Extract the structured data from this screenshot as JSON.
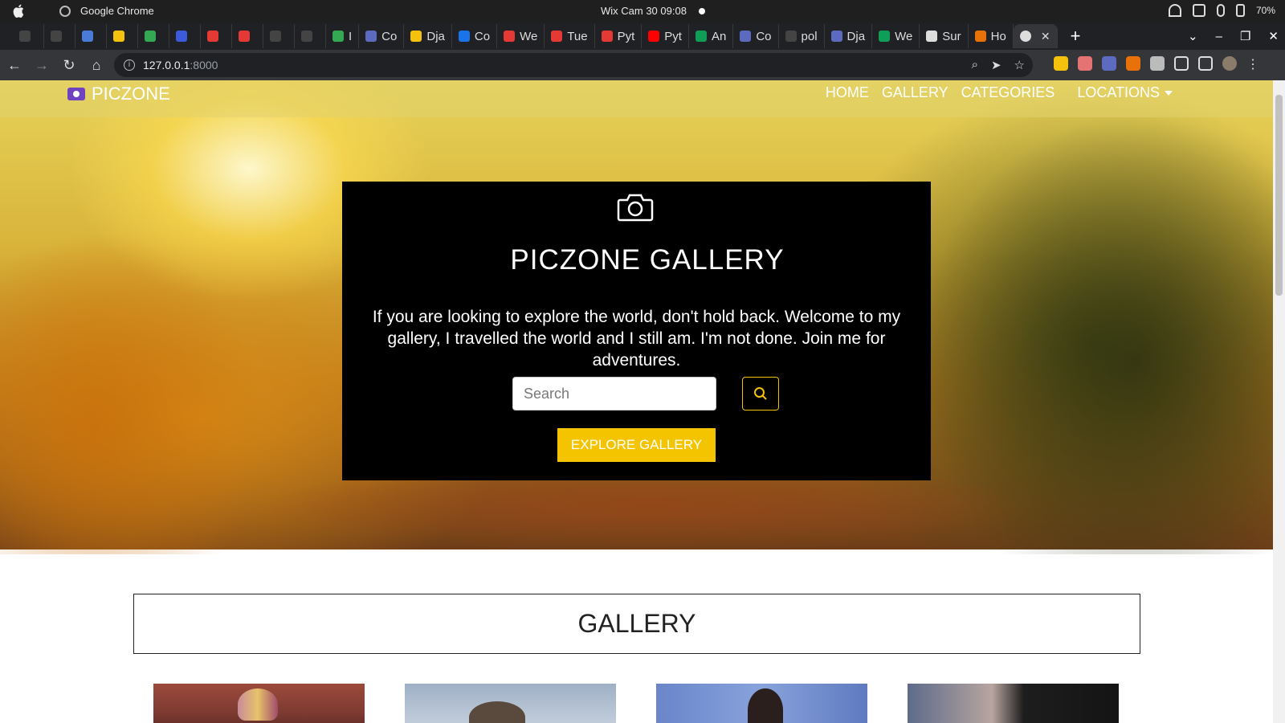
{
  "os": {
    "app_name": "Google Chrome",
    "clock": "Wix Cam 30  09:08",
    "battery": "70%"
  },
  "browser": {
    "tabs": [
      {
        "label": "",
        "color": "#444"
      },
      {
        "label": "",
        "color": "#444"
      },
      {
        "label": "",
        "color": "#4a7bd8"
      },
      {
        "label": "",
        "color": "#f4c20d"
      },
      {
        "label": "",
        "color": "#34a853"
      },
      {
        "label": "",
        "color": "#3b5bdb"
      },
      {
        "label": "",
        "color": "#e53935"
      },
      {
        "label": "",
        "color": "#e53935"
      },
      {
        "label": "",
        "color": "#444"
      },
      {
        "label": "",
        "color": "#444"
      },
      {
        "label": "I",
        "color": "#34a853"
      },
      {
        "label": "Co",
        "color": "#5c6bc0"
      },
      {
        "label": "Dja",
        "color": "#f4c20d"
      },
      {
        "label": "Co",
        "color": "#1a73e8"
      },
      {
        "label": "We",
        "color": "#e53935"
      },
      {
        "label": "Tue",
        "color": "#e53935"
      },
      {
        "label": "Pyt",
        "color": "#e53935"
      },
      {
        "label": "Pyt",
        "color": "#ff0000"
      },
      {
        "label": "An",
        "color": "#0f9d58"
      },
      {
        "label": "Co",
        "color": "#5c6bc0"
      },
      {
        "label": "pol",
        "color": "#444"
      },
      {
        "label": "Dja",
        "color": "#5c6bc0"
      },
      {
        "label": "We",
        "color": "#0f9d58"
      },
      {
        "label": "Sur",
        "color": "#dddddd"
      },
      {
        "label": "Ho",
        "color": "#e8710a"
      }
    ],
    "active_tab_label": "",
    "url_host": "127.0.0.1",
    "url_port": ":8000"
  },
  "site": {
    "brand": "PICZONE",
    "nav": {
      "home": "HOME",
      "gallery": "GALLERY",
      "categories": "CATEGORIES",
      "locations": "LOCATIONS"
    },
    "hero": {
      "title": "PICZONE GALLERY",
      "text": "If you are looking to explore the world, don't hold back. Welcome to my gallery, I travelled the world and I still am. I'm not done. Join me for adventures.",
      "search_placeholder": "Search",
      "explore_label": "EXPLORE GALLERY"
    },
    "gallery_heading": "GALLERY",
    "colors": {
      "accent": "#f5c400",
      "brand_icon": "#6f42c1"
    }
  }
}
